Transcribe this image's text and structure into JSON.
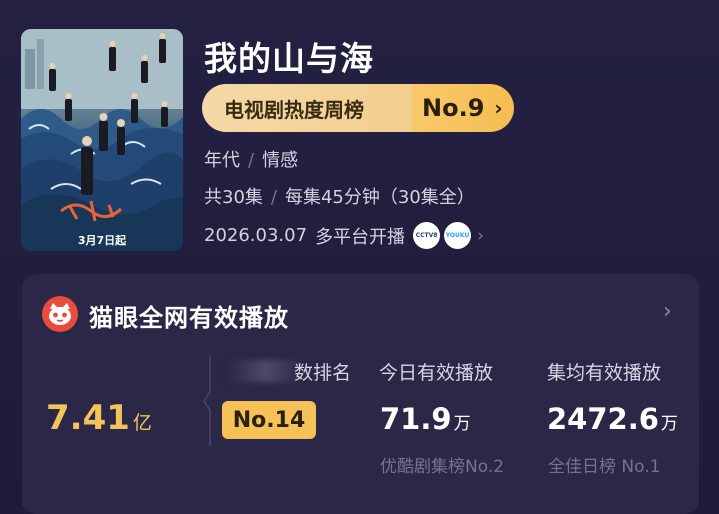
{
  "show": {
    "title": "我的山与海",
    "poster_date": "3月7日起",
    "rank_chip": {
      "label": "电视剧热度周榜",
      "rank": "No.9",
      "chevron": "›"
    },
    "genres": [
      "年代",
      "情感"
    ],
    "genre_sep": "/",
    "episodes": {
      "count": "共30集",
      "duration": "每集45分钟（30集全）"
    },
    "release": {
      "date": "2026.03.07",
      "text": "多平台开播",
      "platforms": [
        {
          "name": "CCTV8",
          "icon": "cctv-logo-icon"
        },
        {
          "name": "YOUKU",
          "icon": "youku-logo-icon"
        }
      ],
      "chevron": "›"
    }
  },
  "card": {
    "logo_icon": "maoyan-cat-icon",
    "title": "猫眼全网有效播放",
    "chevron": "›",
    "columns": {
      "rank_header_suffix": "数排名",
      "today_header": "今日有效播放",
      "avg_header": "集均有效播放"
    },
    "total": {
      "value": "7.41",
      "unit": "亿"
    },
    "rank_badge": "No.14",
    "today": {
      "value": "71.9",
      "unit": "万",
      "footnote": "优酷剧集榜No.2"
    },
    "avg": {
      "value": "2472.6",
      "unit": "万",
      "footnote": "全佳日榜 No.1"
    }
  },
  "colors": {
    "background": "#1f1c3a",
    "card": "#2a2747",
    "accent_gold": "#f6c156",
    "chip_light": "#f4d9a8",
    "maoyan_red": "#e94b3c"
  }
}
